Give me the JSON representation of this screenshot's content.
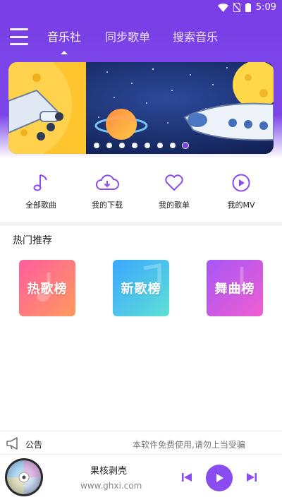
{
  "status_bar": {
    "time": "5:09"
  },
  "header": {
    "tabs": [
      {
        "label": "音乐社",
        "active": true
      },
      {
        "label": "同步歌单",
        "active": false
      },
      {
        "label": "搜索音乐",
        "active": false
      }
    ]
  },
  "banner": {
    "dots": 8,
    "active_dot": 7
  },
  "quick_actions": [
    {
      "label": "全部歌曲",
      "icon": "music-note-icon"
    },
    {
      "label": "我的下载",
      "icon": "cloud-download-icon"
    },
    {
      "label": "我的歌单",
      "icon": "heart-icon"
    },
    {
      "label": "我的MV",
      "icon": "play-circle-icon"
    }
  ],
  "hot": {
    "title": "热门推荐",
    "cards": [
      {
        "label": "热歌榜",
        "color_from": "#ff5d9e",
        "color_to": "#ff9a5e"
      },
      {
        "label": "新歌榜",
        "color_from": "#3aa7ff",
        "color_to": "#5fe0d6"
      },
      {
        "label": "舞曲榜",
        "color_from": "#a855f7",
        "color_to": "#ef5fd0"
      }
    ]
  },
  "notice": {
    "label": "公告",
    "text": "本软件免费使用,请勿上当受骗"
  },
  "player": {
    "title": "果核剥壳",
    "artist": "www.ghxi.com"
  },
  "colors": {
    "accent": "#7b44e8",
    "play": "#8a4cf0"
  }
}
